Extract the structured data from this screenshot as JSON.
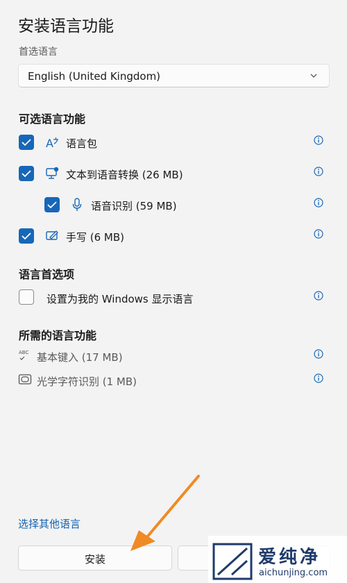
{
  "page": {
    "title": "安装语言功能"
  },
  "preferred": {
    "label": "首选语言",
    "selected": "English (United Kingdom)"
  },
  "optional": {
    "heading": "可选语言功能",
    "items": [
      {
        "label": "语言包",
        "checked": true,
        "icon": "language-pack-icon"
      },
      {
        "label": "文本到语音转换 (26 MB)",
        "checked": true,
        "icon": "text-to-speech-icon"
      },
      {
        "label": "语音识别 (59 MB)",
        "checked": true,
        "icon": "microphone-icon"
      },
      {
        "label": "手写 (6 MB)",
        "checked": true,
        "icon": "handwriting-icon"
      }
    ]
  },
  "prefs": {
    "heading": "语言首选项",
    "display_label": "设置为我的 Windows 显示语言",
    "display_checked": false
  },
  "required": {
    "heading": "所需的语言功能",
    "items": [
      {
        "label": "基本键入 (17 MB)",
        "icon": "abc-typing-icon"
      },
      {
        "label": "光学字符识别 (1 MB)",
        "icon": "ocr-icon"
      }
    ]
  },
  "footer": {
    "link": "选择其他语言",
    "install_label": "安装"
  },
  "watermark": {
    "brand": "爱纯净",
    "url": "aichunjing.com"
  },
  "colors": {
    "accent": "#1767b8",
    "link": "#1261b0",
    "arrow": "#f08a24"
  }
}
